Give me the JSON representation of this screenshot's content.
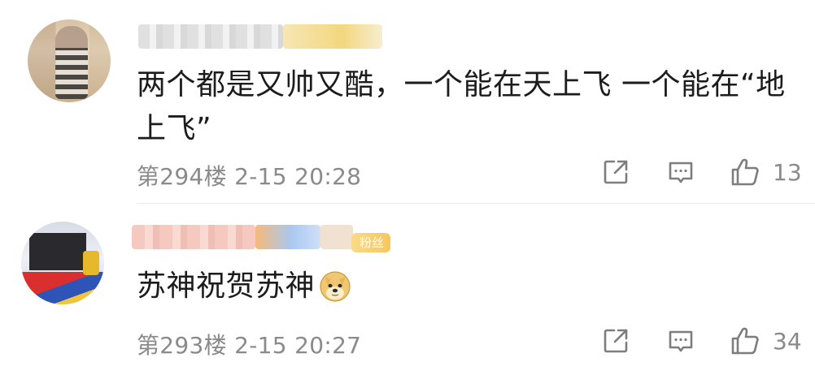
{
  "comments": [
    {
      "text": "两个都是又帅又酷，一个能在天上飞 一个能在“地上飞”",
      "floor": "第294楼",
      "date": "2-15",
      "time": "20:28",
      "likes": "13"
    },
    {
      "text": "苏神祝贺苏神",
      "emoji": "doge-emoji",
      "badge": "粉丝",
      "floor": "第293楼",
      "date": "2-15",
      "time": "20:27",
      "likes": "34"
    }
  ],
  "icons": {
    "share": "share-icon",
    "reply": "reply-icon",
    "like": "thumbs-up-icon"
  },
  "colors": {
    "text": "#1c1c1c",
    "meta": "#8a8a8a",
    "badge": "#f7c75c"
  }
}
